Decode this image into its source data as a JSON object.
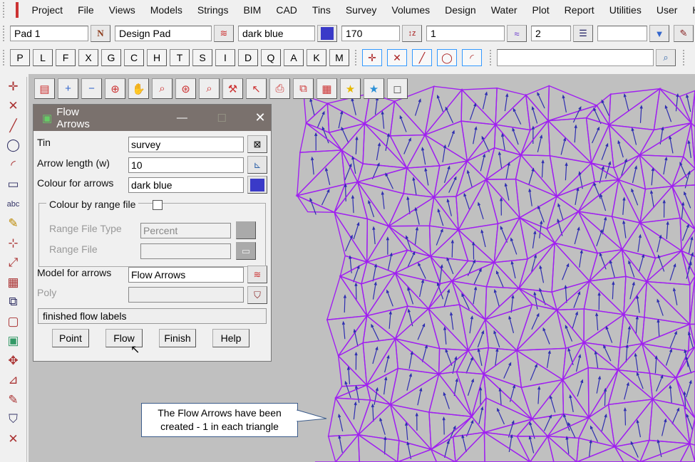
{
  "menu": [
    "Project",
    "File",
    "Views",
    "Models",
    "Strings",
    "BIM",
    "CAD",
    "Tins",
    "Survey",
    "Volumes",
    "Design",
    "Water",
    "Plot",
    "Report",
    "Utilities",
    "User",
    "Help"
  ],
  "toolbar": {
    "name": "Pad 1",
    "model": "Design Pad",
    "colour": "dark blue",
    "colour_hex": "#3a3ac8",
    "value1": "170",
    "value2": "1",
    "value3": "2",
    "value4": ""
  },
  "letters": [
    "P",
    "L",
    "F",
    "X",
    "G",
    "C",
    "H",
    "T",
    "S",
    "I",
    "D",
    "Q",
    "A",
    "K",
    "M"
  ],
  "search": {
    "value": ""
  },
  "dialog": {
    "title": "Flow Arrows",
    "tin_label": "Tin",
    "tin": "survey",
    "length_label": "Arrow length (w)",
    "length": "10",
    "colour_label": "Colour for arrows",
    "colour": "dark blue",
    "range_label": "Colour by range file",
    "range_checked": false,
    "range_type_label": "Range File Type",
    "range_type": "Percent",
    "range_file_label": "Range File",
    "range_file": "",
    "model_label": "Model for arrows",
    "model": "Flow Arrows",
    "poly_label": "Poly",
    "poly": "",
    "status": "finished flow labels",
    "buttons": [
      "Point",
      "Flow",
      "Finish",
      "Help"
    ]
  },
  "callout": {
    "line1": "The Flow Arrows have been",
    "line2": "created - 1 in each triangle"
  },
  "colors": {
    "mesh": "#a020f0",
    "arrows": "#2d2db0",
    "canvas": "#c0c0c0"
  }
}
